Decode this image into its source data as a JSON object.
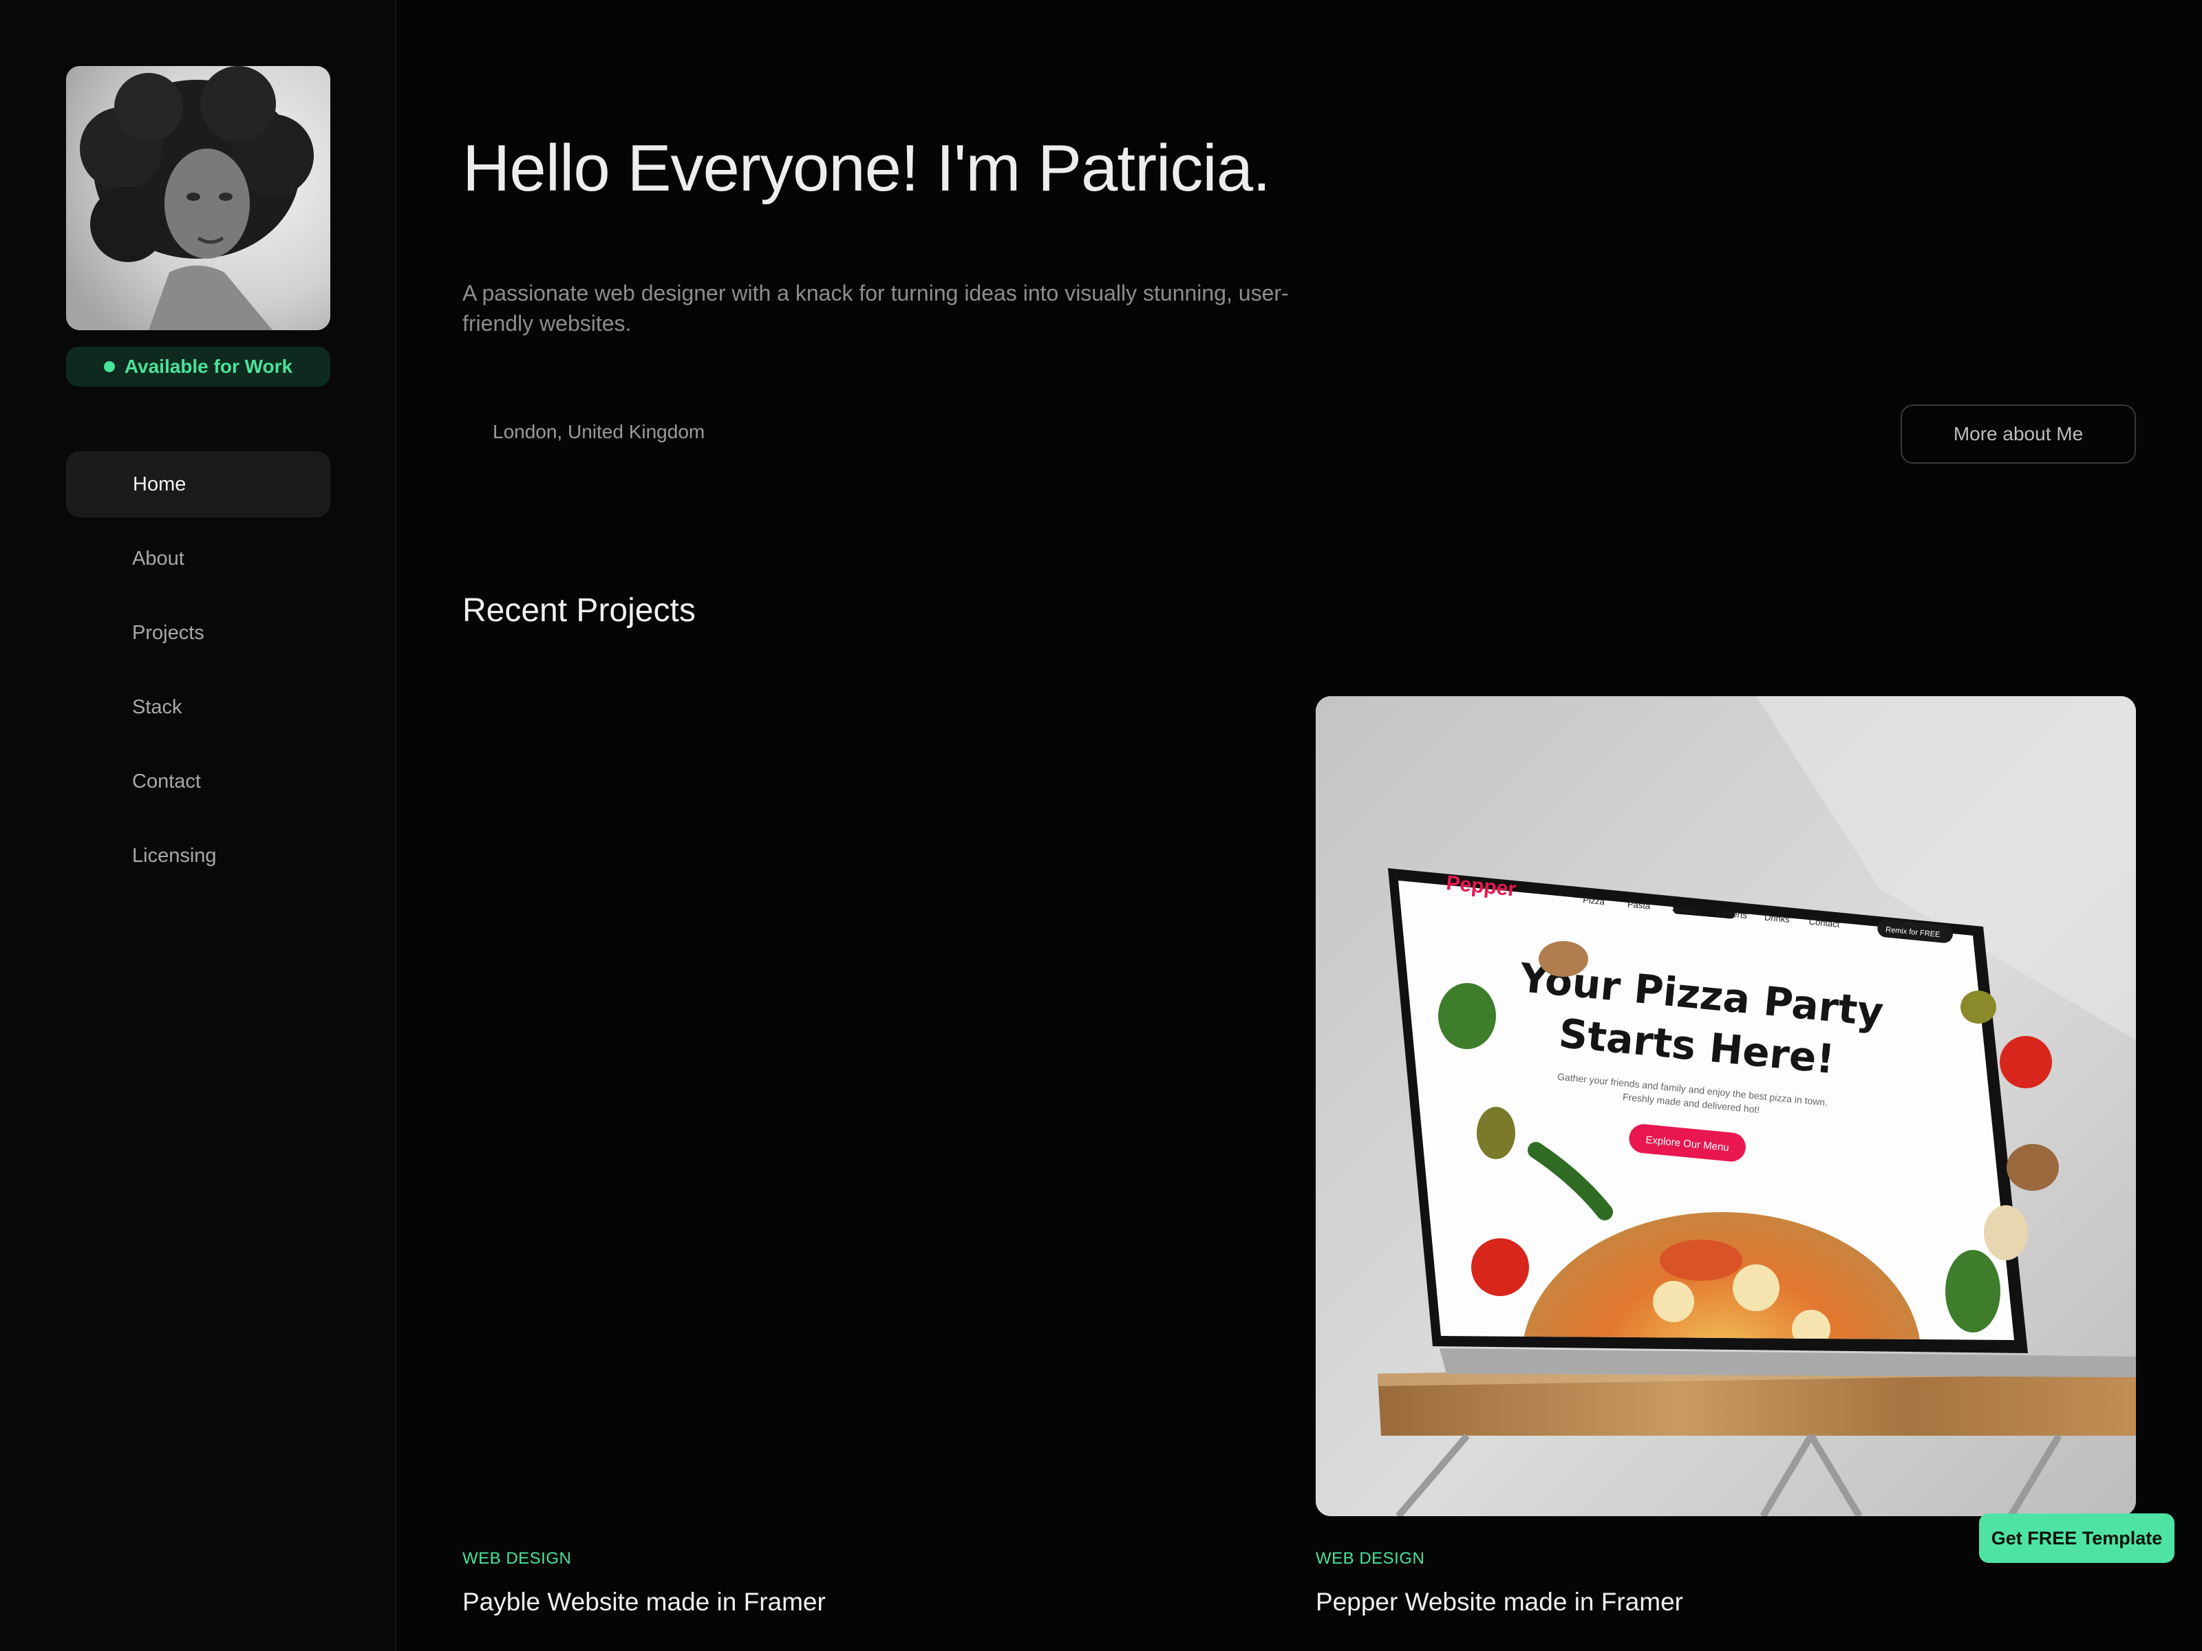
{
  "sidebar": {
    "availability": "Available for Work",
    "nav": [
      {
        "label": "Home",
        "active": true
      },
      {
        "label": "About",
        "active": false
      },
      {
        "label": "Projects",
        "active": false
      },
      {
        "label": "Stack",
        "active": false
      },
      {
        "label": "Contact",
        "active": false
      },
      {
        "label": "Licensing",
        "active": false
      }
    ]
  },
  "hero": {
    "title": "Hello Everyone! I'm Patricia.",
    "description": "A passionate web designer with a knack for turning ideas into visually stunning, user-friendly websites.",
    "location": "London, United Kingdom",
    "more_button": "More about Me"
  },
  "projects": {
    "heading": "Recent Projects",
    "items": [
      {
        "tag": "WEB DESIGN",
        "title": "Payble Website made in Framer"
      },
      {
        "tag": "WEB DESIGN",
        "title": "Pepper Website made in Framer"
      }
    ]
  },
  "mockup": {
    "brand": "Pepper",
    "nav": [
      "Pizza",
      "Pasta",
      "Sides",
      "Deserts",
      "Drinks",
      "Contact"
    ],
    "cta_top": "Remix for FREE",
    "headline_1": "Your Pizza Party",
    "headline_2": "Starts Here!",
    "sub_1": "Gather your friends and family and enjoy the best pizza in town.",
    "sub_2": "Freshly made and delivered hot!",
    "cta": "Explore Our Menu"
  },
  "template_button": "Get FREE Template",
  "colors": {
    "accent": "#49e39b",
    "background": "#050505",
    "pepper_red": "#e8174f"
  }
}
